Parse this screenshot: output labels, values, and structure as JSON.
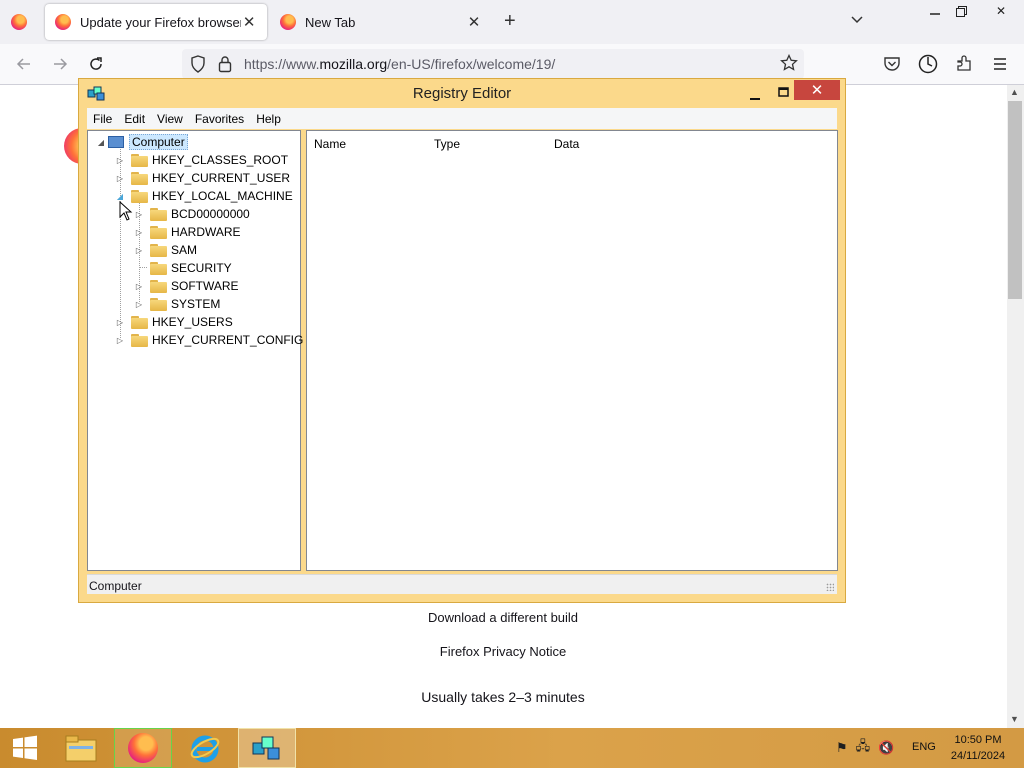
{
  "browser": {
    "tabs": [
      {
        "label": "Update your Firefox browser",
        "active": true
      },
      {
        "label": "New Tab",
        "active": false
      }
    ],
    "url": {
      "prefix": "https://www.",
      "host": "mozilla.org",
      "path": "/en-US/firefox/welcome/19/"
    },
    "accent": "#ff7139"
  },
  "page": {
    "download_link": "Download a different build",
    "privacy_link": "Firefox Privacy Notice",
    "note": "Usually takes 2–3 minutes"
  },
  "regedit": {
    "title": "Registry Editor",
    "menu": [
      "File",
      "Edit",
      "View",
      "Favorites",
      "Help"
    ],
    "tree": {
      "root": "Computer",
      "hives": [
        "HKEY_CLASSES_ROOT",
        "HKEY_CURRENT_USER",
        "HKEY_LOCAL_MACHINE",
        "HKEY_USERS",
        "HKEY_CURRENT_CONFIG"
      ],
      "hklm_children": [
        "BCD00000000",
        "HARDWARE",
        "SAM",
        "SECURITY",
        "SOFTWARE",
        "SYSTEM"
      ]
    },
    "columns": [
      "Name",
      "Type",
      "Data"
    ],
    "status": "Computer",
    "close_color": "#c7463e"
  },
  "taskbar": {
    "apps": [
      "file-explorer",
      "firefox",
      "internet-explorer",
      "registry-editor"
    ],
    "language": "ENG",
    "time": "10:50 PM",
    "date": "24/11/2024"
  }
}
